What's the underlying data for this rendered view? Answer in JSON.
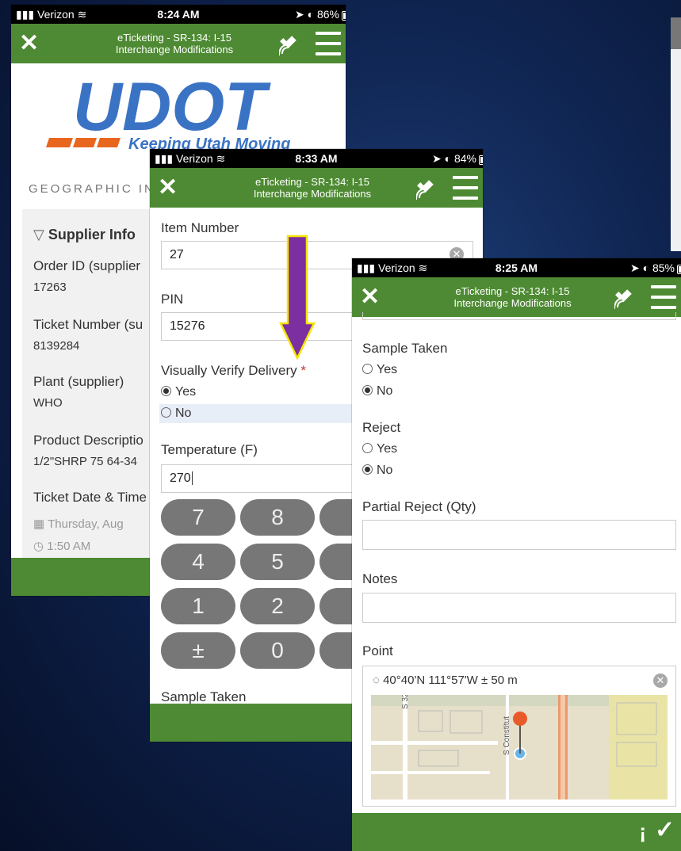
{
  "app_title_line1": "eTicketing - SR-134: I-15",
  "app_title_line2": "Interchange Modifications",
  "close_glyph": "✕",
  "phone1": {
    "carrier": "Verizon",
    "time": "8:24 AM",
    "battery": "86%",
    "logo_text": "UDOT",
    "tagline": "Keeping Utah Moving",
    "geographic": "GEOGRAPHIC IN",
    "section_title": "Supplier Info",
    "fields": [
      {
        "label": "Order ID (supplier",
        "value": "17263"
      },
      {
        "label": "Ticket Number (su",
        "value": "8139284"
      },
      {
        "label": "Plant (supplier)",
        "value": "WHO"
      },
      {
        "label": "Product Descriptio",
        "value": "1/2\"SHRP 75 64-34"
      },
      {
        "label": "Ticket Date & Time",
        "value": ""
      }
    ],
    "date_value": "Thursday, Aug",
    "time_value": "1:50 AM"
  },
  "phone2": {
    "carrier": "Verizon",
    "time": "8:33 AM",
    "battery": "84%",
    "item_number_label": "Item Number",
    "item_number_value": "27",
    "pin_label": "PIN",
    "pin_value": "15276",
    "verify_label": "Visually Verify Delivery",
    "required_mark": "*",
    "yes": "Yes",
    "no": "No",
    "temp_label": "Temperature (F)",
    "temp_value": "270",
    "keys": [
      "7",
      "8",
      "4",
      "5",
      "1",
      "2",
      "±",
      "0"
    ],
    "sample_taken": "Sample Taken"
  },
  "phone3": {
    "carrier": "Verizon",
    "time": "8:25 AM",
    "battery": "85%",
    "sample_taken_label": "Sample Taken",
    "reject_label": "Reject",
    "yes": "Yes",
    "no": "No",
    "partial_reject_label": "Partial Reject (Qty)",
    "notes_label": "Notes",
    "point_label": "Point",
    "point_value": "40°40'N 111°57'W ± 50 m",
    "map_street1": "S 3200",
    "map_street2": "S Constitut"
  },
  "colors": {
    "appbar": "#4e8a33",
    "arrow": "#7b2fa0",
    "arrow_outline": "#f5e400",
    "logo_blue": "#3b73c4",
    "logo_orange": "#e8661e"
  }
}
